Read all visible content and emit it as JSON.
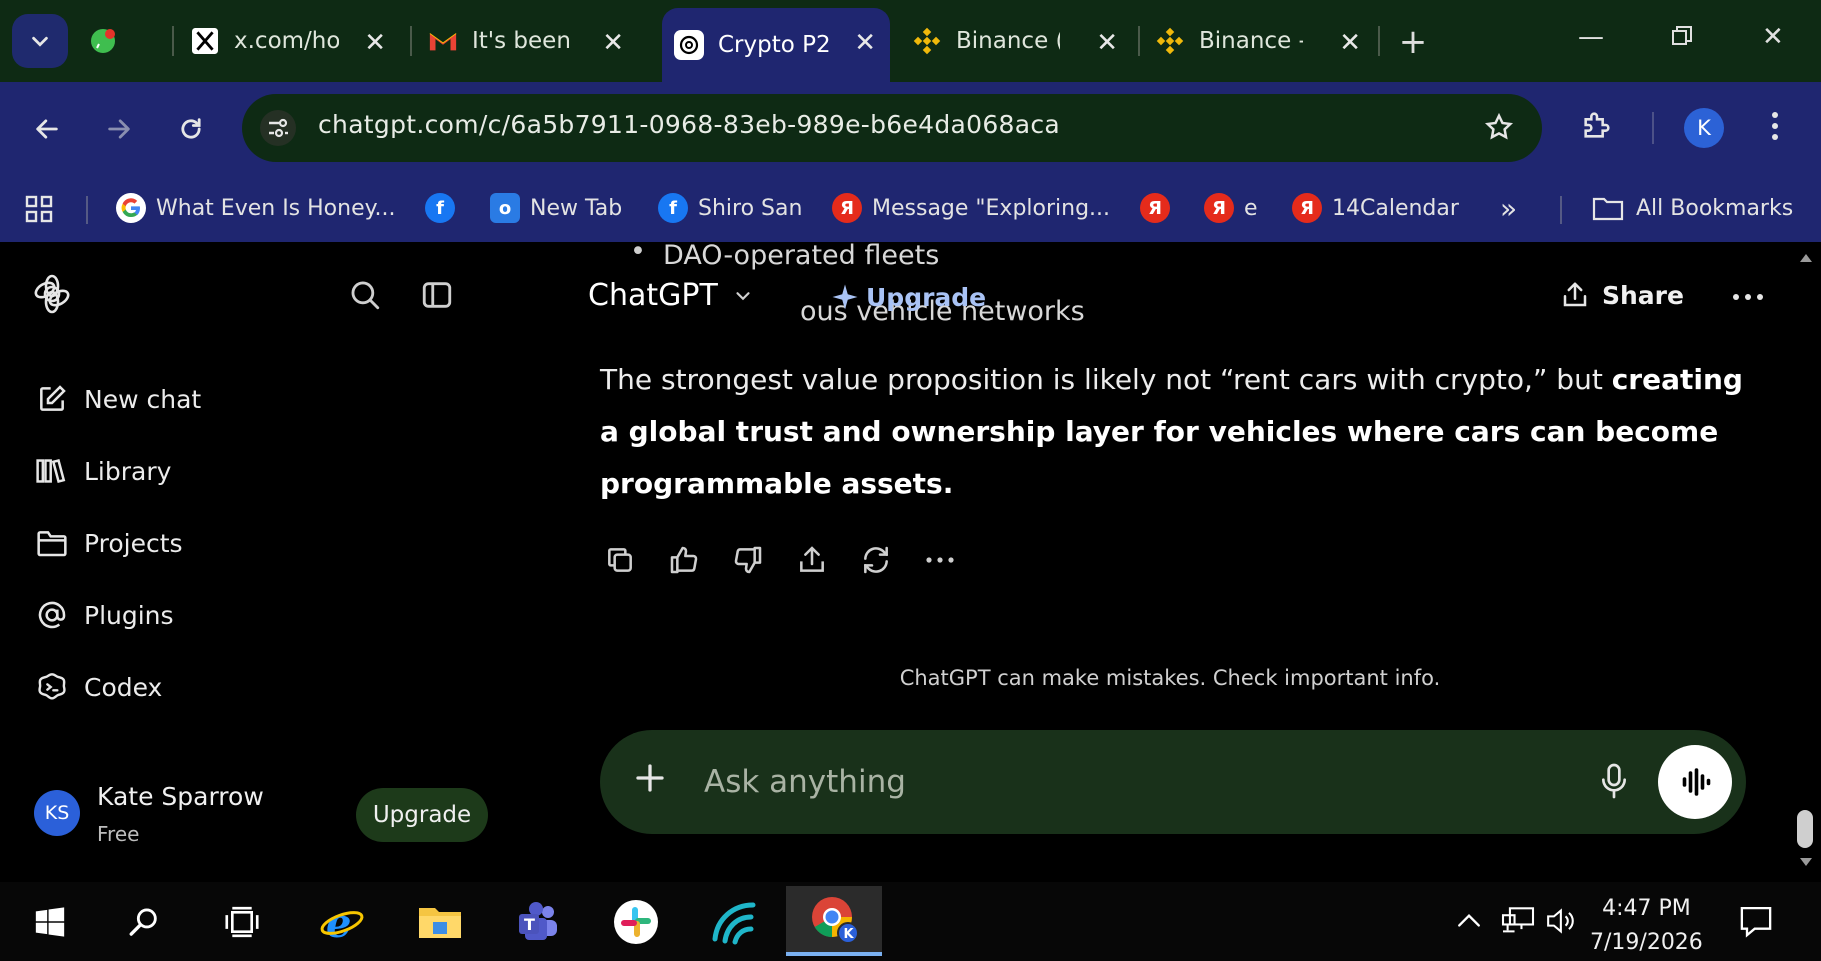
{
  "browser": {
    "tabs": [
      {
        "title": "",
        "favicon": "whatsapp-icon"
      },
      {
        "title": "x.com/ho",
        "favicon": "x-logo-icon"
      },
      {
        "title": "It's been",
        "favicon": "gmail-icon"
      },
      {
        "title": "Crypto P2",
        "favicon": "openai-icon",
        "active": true
      },
      {
        "title": "Binance (",
        "favicon": "binance-icon"
      },
      {
        "title": "Binance -",
        "favicon": "binance-icon"
      }
    ],
    "url": "chatgpt.com/c/6a5b7911-0968-83eb-989e-b6e4da068aca",
    "profile_initial": "K"
  },
  "bookmarks": [
    {
      "label": "What Even Is Honey...",
      "icon": "google-icon"
    },
    {
      "label": "",
      "icon": "facebook-icon"
    },
    {
      "label": "New Tab",
      "icon": "outlook-icon"
    },
    {
      "label": "Shiro San",
      "icon": "facebook-icon"
    },
    {
      "label": "Message \"Exploring...",
      "icon": "yandex-icon"
    },
    {
      "label": "",
      "icon": "yandex-icon"
    },
    {
      "label": "e",
      "icon": "yandex-icon"
    },
    {
      "label": "14Calendar",
      "icon": "yandex-icon"
    }
  ],
  "bookmarks_overflow": "»",
  "all_bookmarks_label": "All Bookmarks",
  "sidebar": {
    "items": [
      {
        "label": "New chat",
        "icon": "edit-icon"
      },
      {
        "label": "Library",
        "icon": "library-icon"
      },
      {
        "label": "Projects",
        "icon": "folder-icon"
      },
      {
        "label": "Plugins",
        "icon": "at-icon"
      },
      {
        "label": "Codex",
        "icon": "codex-icon"
      }
    ],
    "user": {
      "initials": "KS",
      "name": "Kate Sparrow",
      "plan": "Free"
    },
    "upgrade_label": "Upgrade"
  },
  "main": {
    "model_label": "ChatGPT",
    "upgrade_label": "Upgrade",
    "share_label": "Share",
    "peek_line_1": "DAO-operated fleets",
    "peek_line_2": "ous vehicle networks",
    "answer_plain": "The strongest value proposition is likely not “rent cars with crypto,” but ",
    "answer_bold": "creating a global trust and ownership layer for vehicles where cars can become programmable assets.",
    "disclaimer": "ChatGPT can make mistakes. Check important info.",
    "composer_placeholder": "Ask anything"
  },
  "taskbar": {
    "time": "4:47 PM",
    "date": "7/19/2026"
  }
}
